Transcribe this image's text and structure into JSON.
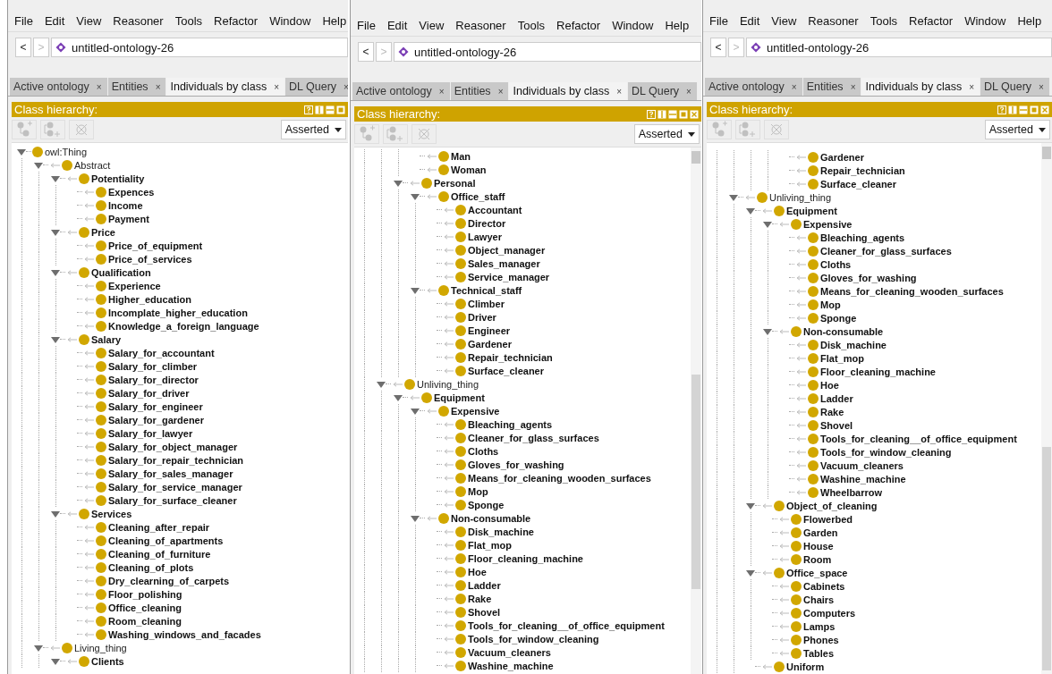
{
  "panels": [
    {
      "closable": false,
      "menu": [
        "File",
        "Edit",
        "View",
        "Reasoner",
        "Tools",
        "Refactor",
        "Window",
        "Help"
      ],
      "back": {
        "label": "<",
        "disabled": false
      },
      "forward": {
        "label": ">",
        "disabled": true
      },
      "ontology": "untitled-ontology-26",
      "tabs": [
        {
          "label": "Active ontology",
          "close": "×",
          "selected": false
        },
        {
          "label": "Entities",
          "close": "×",
          "selected": false
        },
        {
          "label": "Individuals by class",
          "close": "×",
          "selected": true
        },
        {
          "label": "DL Query",
          "close": "×",
          "selected": false
        }
      ],
      "view_title": "Class hierarchy:",
      "toolbar_disabled": true,
      "mode": "Asserted",
      "tree": [
        {
          "label": "owl:Thing",
          "bold": false,
          "expanded": true,
          "children": [
            {
              "label": "Abstract",
              "bold": false,
              "expanded": true,
              "children": [
                {
                  "label": "Potentiality",
                  "bold": true,
                  "expanded": true,
                  "children": [
                    {
                      "label": "Expences",
                      "bold": true
                    },
                    {
                      "label": "Income",
                      "bold": true
                    },
                    {
                      "label": "Payment",
                      "bold": true
                    }
                  ]
                },
                {
                  "label": "Price",
                  "bold": true,
                  "expanded": true,
                  "children": [
                    {
                      "label": "Price_of_equipment",
                      "bold": true
                    },
                    {
                      "label": "Price_of_services",
                      "bold": true
                    }
                  ]
                },
                {
                  "label": "Qualification",
                  "bold": true,
                  "expanded": true,
                  "children": [
                    {
                      "label": "Experience",
                      "bold": true
                    },
                    {
                      "label": "Higher_education",
                      "bold": true
                    },
                    {
                      "label": "Incomplate_higher_education",
                      "bold": true
                    },
                    {
                      "label": "Knowledge_a_foreign_language",
                      "bold": true
                    }
                  ]
                },
                {
                  "label": "Salary",
                  "bold": true,
                  "expanded": true,
                  "children": [
                    {
                      "label": "Salary_for_accountant",
                      "bold": true
                    },
                    {
                      "label": "Salary_for_climber",
                      "bold": true
                    },
                    {
                      "label": "Salary_for_director",
                      "bold": true
                    },
                    {
                      "label": "Salary_for_driver",
                      "bold": true
                    },
                    {
                      "label": "Salary_for_engineer",
                      "bold": true
                    },
                    {
                      "label": "Salary_for_gardener",
                      "bold": true
                    },
                    {
                      "label": "Salary_for_lawyer",
                      "bold": true
                    },
                    {
                      "label": "Salary_for_object_manager",
                      "bold": true
                    },
                    {
                      "label": "Salary_for_repair_technician",
                      "bold": true
                    },
                    {
                      "label": "Salary_for_sales_manager",
                      "bold": true
                    },
                    {
                      "label": "Salary_for_service_manager",
                      "bold": true
                    },
                    {
                      "label": "Salary_for_surface_cleaner",
                      "bold": true
                    }
                  ]
                },
                {
                  "label": "Services",
                  "bold": true,
                  "expanded": true,
                  "children": [
                    {
                      "label": "Cleaning_after_repair",
                      "bold": true
                    },
                    {
                      "label": "Cleaning_of_apartments",
                      "bold": true
                    },
                    {
                      "label": "Cleaning_of_furniture",
                      "bold": true
                    },
                    {
                      "label": "Cleaning_of_plots",
                      "bold": true
                    },
                    {
                      "label": "Dry_clearning_of_carpets",
                      "bold": true
                    },
                    {
                      "label": "Floor_polishing",
                      "bold": true
                    },
                    {
                      "label": "Office_cleaning",
                      "bold": true
                    },
                    {
                      "label": "Room_cleaning",
                      "bold": true
                    },
                    {
                      "label": "Washing_windows_and_facades",
                      "bold": true
                    }
                  ]
                }
              ]
            },
            {
              "label": "Living_thing",
              "bold": false,
              "expanded": true,
              "children": [
                {
                  "label": "Clients",
                  "bold": true,
                  "expanded": true
                }
              ]
            }
          ]
        }
      ]
    },
    {
      "closable": true,
      "menu": [
        "File",
        "Edit",
        "View",
        "Reasoner",
        "Tools",
        "Refactor",
        "Window",
        "Help"
      ],
      "back": {
        "label": "<",
        "disabled": false
      },
      "forward": {
        "label": ">",
        "disabled": true
      },
      "ontology": "untitled-ontology-26",
      "tabs": [
        {
          "label": "Active ontology",
          "close": "×",
          "selected": false
        },
        {
          "label": "Entities",
          "close": "×",
          "selected": false
        },
        {
          "label": "Individuals by class",
          "close": "×",
          "selected": true
        },
        {
          "label": "DL Query",
          "close": "×",
          "selected": false
        }
      ],
      "view_title": "Class hierarchy:",
      "toolbar_disabled": true,
      "mode": "Asserted",
      "tree": [
        {
          "children": [
            {
              "children": [
                {
                  "children": [
                    {
                      "label": "Man",
                      "bold": true
                    },
                    {
                      "label": "Woman",
                      "bold": true
                    }
                  ]
                },
                {
                  "label": "Personal",
                  "bold": true,
                  "expanded": true,
                  "children": [
                    {
                      "label": "Office_staff",
                      "bold": true,
                      "expanded": true,
                      "children": [
                        {
                          "label": "Accountant",
                          "bold": true
                        },
                        {
                          "label": "Director",
                          "bold": true
                        },
                        {
                          "label": "Lawyer",
                          "bold": true
                        },
                        {
                          "label": "Object_manager",
                          "bold": true
                        },
                        {
                          "label": "Sales_manager",
                          "bold": true
                        },
                        {
                          "label": "Service_manager",
                          "bold": true
                        }
                      ]
                    },
                    {
                      "label": "Technical_staff",
                      "bold": true,
                      "expanded": true,
                      "children": [
                        {
                          "label": "Climber",
                          "bold": true
                        },
                        {
                          "label": "Driver",
                          "bold": true
                        },
                        {
                          "label": "Engineer",
                          "bold": true
                        },
                        {
                          "label": "Gardener",
                          "bold": true
                        },
                        {
                          "label": "Repair_technician",
                          "bold": true
                        },
                        {
                          "label": "Surface_cleaner",
                          "bold": true
                        }
                      ]
                    }
                  ]
                }
              ]
            },
            {
              "label": "Unliving_thing",
              "bold": false,
              "expanded": true,
              "children": [
                {
                  "label": "Equipment",
                  "bold": true,
                  "expanded": true,
                  "children": [
                    {
                      "label": "Expensive",
                      "bold": true,
                      "expanded": true,
                      "children": [
                        {
                          "label": "Bleaching_agents",
                          "bold": true
                        },
                        {
                          "label": "Cleaner_for_glass_surfaces",
                          "bold": true
                        },
                        {
                          "label": "Cloths",
                          "bold": true
                        },
                        {
                          "label": "Gloves_for_washing",
                          "bold": true
                        },
                        {
                          "label": "Means_for_cleaning_wooden_surfaces",
                          "bold": true
                        },
                        {
                          "label": "Mop",
                          "bold": true
                        },
                        {
                          "label": "Sponge",
                          "bold": true
                        }
                      ]
                    },
                    {
                      "label": "Non-consumable",
                      "bold": true,
                      "expanded": true,
                      "children": [
                        {
                          "label": "Disk_machine",
                          "bold": true
                        },
                        {
                          "label": "Flat_mop",
                          "bold": true
                        },
                        {
                          "label": "Floor_cleaning_machine",
                          "bold": true
                        },
                        {
                          "label": "Hoe",
                          "bold": true
                        },
                        {
                          "label": "Ladder",
                          "bold": true
                        },
                        {
                          "label": "Rake",
                          "bold": true
                        },
                        {
                          "label": "Shovel",
                          "bold": true
                        },
                        {
                          "label": "Tools_for_cleaning__of_office_equipment",
                          "bold": true
                        },
                        {
                          "label": "Tools_for_window_cleaning",
                          "bold": true
                        },
                        {
                          "label": "Vacuum_cleaners",
                          "bold": true
                        },
                        {
                          "label": "Washine_machine",
                          "bold": true
                        }
                      ]
                    }
                  ]
                }
              ]
            }
          ]
        }
      ]
    },
    {
      "closable": true,
      "menu": [
        "File",
        "Edit",
        "View",
        "Reasoner",
        "Tools",
        "Refactor",
        "Window",
        "Help"
      ],
      "back": {
        "label": "<",
        "disabled": false
      },
      "forward": {
        "label": ">",
        "disabled": true
      },
      "ontology": "untitled-ontology-26",
      "tabs": [
        {
          "label": "Active ontology",
          "close": "×",
          "selected": false
        },
        {
          "label": "Entities",
          "close": "×",
          "selected": false
        },
        {
          "label": "Individuals by class",
          "close": "×",
          "selected": true
        },
        {
          "label": "DL Query",
          "close": "×",
          "selected": false
        }
      ],
      "view_title": "Class hierarchy:",
      "toolbar_disabled": true,
      "mode": "Asserted",
      "tree": [
        {
          "children": [
            {
              "children": [
                {
                  "children": [
                    {
                      "children": [
                        {
                          "label": "Gardener",
                          "bold": true
                        },
                        {
                          "label": "Repair_technician",
                          "bold": true
                        },
                        {
                          "label": "Surface_cleaner",
                          "bold": true
                        }
                      ]
                    }
                  ]
                }
              ]
            },
            {
              "label": "Unliving_thing",
              "bold": false,
              "expanded": true,
              "children": [
                {
                  "label": "Equipment",
                  "bold": true,
                  "expanded": true,
                  "children": [
                    {
                      "label": "Expensive",
                      "bold": true,
                      "expanded": true,
                      "children": [
                        {
                          "label": "Bleaching_agents",
                          "bold": true
                        },
                        {
                          "label": "Cleaner_for_glass_surfaces",
                          "bold": true
                        },
                        {
                          "label": "Cloths",
                          "bold": true
                        },
                        {
                          "label": "Gloves_for_washing",
                          "bold": true
                        },
                        {
                          "label": "Means_for_cleaning_wooden_surfaces",
                          "bold": true
                        },
                        {
                          "label": "Mop",
                          "bold": true
                        },
                        {
                          "label": "Sponge",
                          "bold": true
                        }
                      ]
                    },
                    {
                      "label": "Non-consumable",
                      "bold": true,
                      "expanded": true,
                      "children": [
                        {
                          "label": "Disk_machine",
                          "bold": true
                        },
                        {
                          "label": "Flat_mop",
                          "bold": true
                        },
                        {
                          "label": "Floor_cleaning_machine",
                          "bold": true
                        },
                        {
                          "label": "Hoe",
                          "bold": true
                        },
                        {
                          "label": "Ladder",
                          "bold": true
                        },
                        {
                          "label": "Rake",
                          "bold": true
                        },
                        {
                          "label": "Shovel",
                          "bold": true
                        },
                        {
                          "label": "Tools_for_cleaning__of_office_equipment",
                          "bold": true
                        },
                        {
                          "label": "Tools_for_window_cleaning",
                          "bold": true
                        },
                        {
                          "label": "Vacuum_cleaners",
                          "bold": true
                        },
                        {
                          "label": "Washine_machine",
                          "bold": true
                        },
                        {
                          "label": "Wheelbarrow",
                          "bold": true
                        }
                      ]
                    }
                  ]
                },
                {
                  "label": "Object_of_cleaning",
                  "bold": true,
                  "expanded": true,
                  "children": [
                    {
                      "label": "Flowerbed",
                      "bold": true
                    },
                    {
                      "label": "Garden",
                      "bold": true
                    },
                    {
                      "label": "House",
                      "bold": true
                    },
                    {
                      "label": "Room",
                      "bold": true
                    }
                  ]
                },
                {
                  "label": "Office_space",
                  "bold": true,
                  "expanded": true,
                  "children": [
                    {
                      "label": "Cabinets",
                      "bold": true
                    },
                    {
                      "label": "Chairs",
                      "bold": true
                    },
                    {
                      "label": "Computers",
                      "bold": true
                    },
                    {
                      "label": "Lamps",
                      "bold": true
                    },
                    {
                      "label": "Phones",
                      "bold": true
                    },
                    {
                      "label": "Tables",
                      "bold": true
                    }
                  ]
                },
                {
                  "label": "Uniform",
                  "bold": true
                }
              ]
            }
          ]
        }
      ]
    }
  ]
}
